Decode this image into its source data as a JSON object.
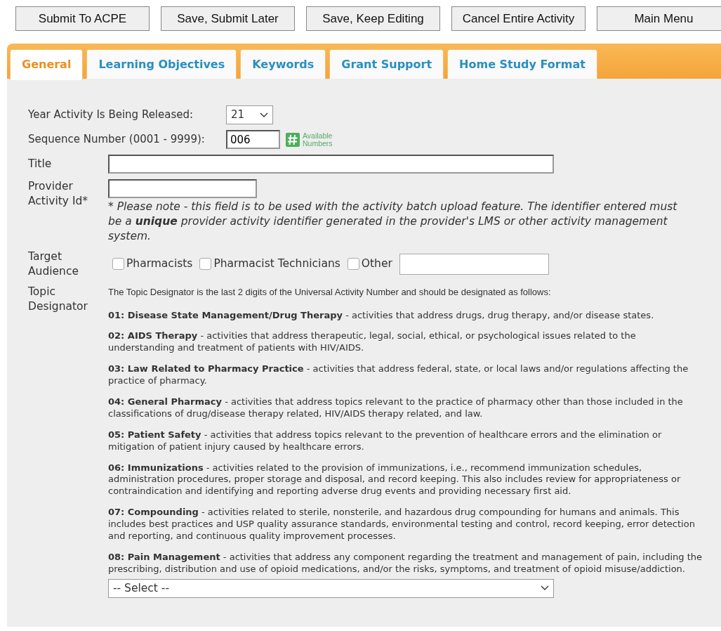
{
  "buttons": [
    {
      "label": "Submit To ACPE"
    },
    {
      "label": "Save, Submit Later"
    },
    {
      "label": "Save, Keep Editing"
    },
    {
      "label": "Cancel Entire Activity"
    },
    {
      "label": "Main Menu"
    }
  ],
  "tabs": [
    {
      "label": "General",
      "selected": true
    },
    {
      "label": "Learning Objectives",
      "selected": false
    },
    {
      "label": "Keywords",
      "selected": false
    },
    {
      "label": "Grant Support",
      "selected": false
    },
    {
      "label": "Home Study Format",
      "selected": false
    }
  ],
  "year": {
    "label": "Year Activity Is Being Released:",
    "value": "21"
  },
  "sequence": {
    "label": "Sequence Number (0001 - 9999):",
    "value": "006",
    "link": "Available Numbers"
  },
  "title_field": {
    "label": "Title"
  },
  "provider_id": {
    "label": "Provider Activity Id*",
    "note": "* Please note - this field is to be used with the activity batch upload feature. The identifier entered must be a **unique** provider activity identifier generated in the provider's LMS or other activity management system."
  },
  "target_audience": {
    "label": "Target Audience",
    "options": [
      {
        "label": "Pharmacists",
        "checked": false
      },
      {
        "label": "Pharmacist Technicians",
        "checked": false
      },
      {
        "label": "Other",
        "checked": false
      }
    ]
  },
  "topic_designator": {
    "label": "Topic Designator",
    "intro": "The Topic Designator is the last 2 digits of the Universal Activity Number and should be designated as follows:",
    "items": [
      "**01: Disease State Management/Drug Therapy** - activities that address drugs, drug therapy, and/or disease states.",
      "**02: AIDS Therapy** - activities that address therapeutic, legal, social, ethical, or psychological issues related to the understanding and treatment of patients with HIV/AIDS.",
      "**03: Law Related to Pharmacy Practice** - activities that address federal, state, or local laws and/or regulations affecting the practice of pharmacy.",
      "**04: General Pharmacy** - activities that address topics relevant to the practice of pharmacy other than those included in the classifications of drug/disease therapy related, HIV/AIDS therapy related, and law.",
      "**05: Patient Safety** - activities that address topics relevant to the prevention of healthcare errors and the elimination or mitigation of patient injury caused by healthcare errors.",
      "**06: Immunizations** - activities related to the provision of immunizations, i.e., recommend immunization schedules, administration procedures, proper storage and disposal, and record keeping. This also includes review for appropriateness or contraindication and identifying and reporting adverse drug events and providing necessary first aid.",
      "**07: Compounding** - activities related to sterile, nonsterile, and hazardous drug compounding for humans and animals. This includes best practices and USP quality assurance standards, environmental testing and control, record keeping, error detection and reporting, and continuous quality improvement processes.",
      "**08: Pain Management** - activities that address any component regarding the treatment and management of pain, including the prescribing, distribution and use of opioid medications, and/or the risks, symptoms, and treatment of opioid misuse/addiction."
    ],
    "select": {
      "value": "-- Select --"
    }
  }
}
